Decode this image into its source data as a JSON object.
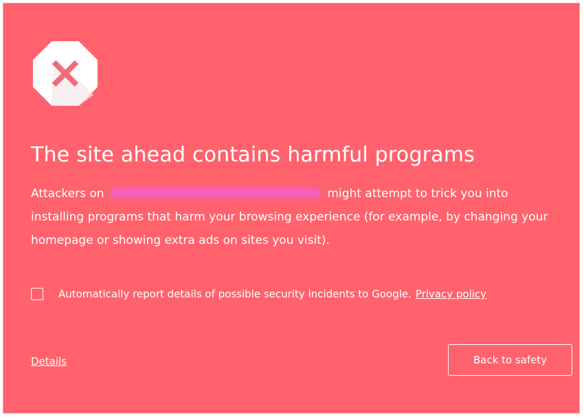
{
  "interstitial": {
    "title": "The site ahead contains harmful programs",
    "body_before_url": "Attackers on",
    "body_after_url": "might attempt to trick you into installing programs that harm your browsing experience (for example, by changing your homepage or showing extra ads on sites you visit).",
    "report_checkbox": {
      "checked": false,
      "label": "Automatically report details of possible security incidents to Google.",
      "privacy_link": "Privacy policy"
    },
    "details_link": "Details",
    "back_button": "Back to safety",
    "icon": "warning-octagon-x-icon"
  },
  "colors": {
    "background": "#ff626c",
    "icon_fill": "#ffffff",
    "icon_x": "#f06c7b",
    "text": "#ffffff"
  }
}
